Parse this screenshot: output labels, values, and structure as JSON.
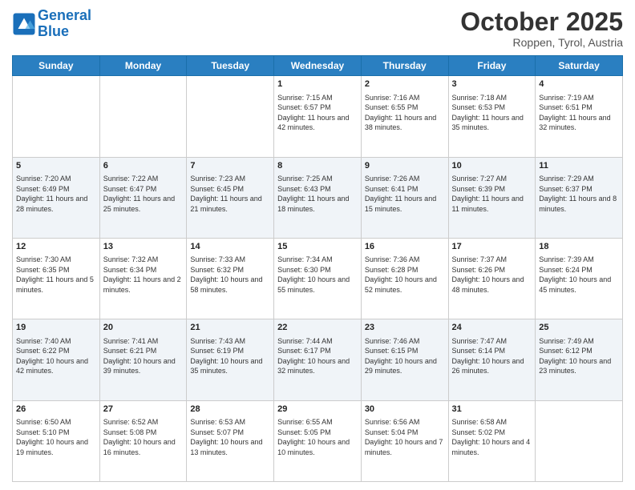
{
  "header": {
    "logo_line1": "General",
    "logo_line2": "Blue",
    "month": "October 2025",
    "location": "Roppen, Tyrol, Austria"
  },
  "days_of_week": [
    "Sunday",
    "Monday",
    "Tuesday",
    "Wednesday",
    "Thursday",
    "Friday",
    "Saturday"
  ],
  "weeks": [
    [
      {
        "day": "",
        "info": ""
      },
      {
        "day": "",
        "info": ""
      },
      {
        "day": "",
        "info": ""
      },
      {
        "day": "1",
        "info": "Sunrise: 7:15 AM\nSunset: 6:57 PM\nDaylight: 11 hours and 42 minutes."
      },
      {
        "day": "2",
        "info": "Sunrise: 7:16 AM\nSunset: 6:55 PM\nDaylight: 11 hours and 38 minutes."
      },
      {
        "day": "3",
        "info": "Sunrise: 7:18 AM\nSunset: 6:53 PM\nDaylight: 11 hours and 35 minutes."
      },
      {
        "day": "4",
        "info": "Sunrise: 7:19 AM\nSunset: 6:51 PM\nDaylight: 11 hours and 32 minutes."
      }
    ],
    [
      {
        "day": "5",
        "info": "Sunrise: 7:20 AM\nSunset: 6:49 PM\nDaylight: 11 hours and 28 minutes."
      },
      {
        "day": "6",
        "info": "Sunrise: 7:22 AM\nSunset: 6:47 PM\nDaylight: 11 hours and 25 minutes."
      },
      {
        "day": "7",
        "info": "Sunrise: 7:23 AM\nSunset: 6:45 PM\nDaylight: 11 hours and 21 minutes."
      },
      {
        "day": "8",
        "info": "Sunrise: 7:25 AM\nSunset: 6:43 PM\nDaylight: 11 hours and 18 minutes."
      },
      {
        "day": "9",
        "info": "Sunrise: 7:26 AM\nSunset: 6:41 PM\nDaylight: 11 hours and 15 minutes."
      },
      {
        "day": "10",
        "info": "Sunrise: 7:27 AM\nSunset: 6:39 PM\nDaylight: 11 hours and 11 minutes."
      },
      {
        "day": "11",
        "info": "Sunrise: 7:29 AM\nSunset: 6:37 PM\nDaylight: 11 hours and 8 minutes."
      }
    ],
    [
      {
        "day": "12",
        "info": "Sunrise: 7:30 AM\nSunset: 6:35 PM\nDaylight: 11 hours and 5 minutes."
      },
      {
        "day": "13",
        "info": "Sunrise: 7:32 AM\nSunset: 6:34 PM\nDaylight: 11 hours and 2 minutes."
      },
      {
        "day": "14",
        "info": "Sunrise: 7:33 AM\nSunset: 6:32 PM\nDaylight: 10 hours and 58 minutes."
      },
      {
        "day": "15",
        "info": "Sunrise: 7:34 AM\nSunset: 6:30 PM\nDaylight: 10 hours and 55 minutes."
      },
      {
        "day": "16",
        "info": "Sunrise: 7:36 AM\nSunset: 6:28 PM\nDaylight: 10 hours and 52 minutes."
      },
      {
        "day": "17",
        "info": "Sunrise: 7:37 AM\nSunset: 6:26 PM\nDaylight: 10 hours and 48 minutes."
      },
      {
        "day": "18",
        "info": "Sunrise: 7:39 AM\nSunset: 6:24 PM\nDaylight: 10 hours and 45 minutes."
      }
    ],
    [
      {
        "day": "19",
        "info": "Sunrise: 7:40 AM\nSunset: 6:22 PM\nDaylight: 10 hours and 42 minutes."
      },
      {
        "day": "20",
        "info": "Sunrise: 7:41 AM\nSunset: 6:21 PM\nDaylight: 10 hours and 39 minutes."
      },
      {
        "day": "21",
        "info": "Sunrise: 7:43 AM\nSunset: 6:19 PM\nDaylight: 10 hours and 35 minutes."
      },
      {
        "day": "22",
        "info": "Sunrise: 7:44 AM\nSunset: 6:17 PM\nDaylight: 10 hours and 32 minutes."
      },
      {
        "day": "23",
        "info": "Sunrise: 7:46 AM\nSunset: 6:15 PM\nDaylight: 10 hours and 29 minutes."
      },
      {
        "day": "24",
        "info": "Sunrise: 7:47 AM\nSunset: 6:14 PM\nDaylight: 10 hours and 26 minutes."
      },
      {
        "day": "25",
        "info": "Sunrise: 7:49 AM\nSunset: 6:12 PM\nDaylight: 10 hours and 23 minutes."
      }
    ],
    [
      {
        "day": "26",
        "info": "Sunrise: 6:50 AM\nSunset: 5:10 PM\nDaylight: 10 hours and 19 minutes."
      },
      {
        "day": "27",
        "info": "Sunrise: 6:52 AM\nSunset: 5:08 PM\nDaylight: 10 hours and 16 minutes."
      },
      {
        "day": "28",
        "info": "Sunrise: 6:53 AM\nSunset: 5:07 PM\nDaylight: 10 hours and 13 minutes."
      },
      {
        "day": "29",
        "info": "Sunrise: 6:55 AM\nSunset: 5:05 PM\nDaylight: 10 hours and 10 minutes."
      },
      {
        "day": "30",
        "info": "Sunrise: 6:56 AM\nSunset: 5:04 PM\nDaylight: 10 hours and 7 minutes."
      },
      {
        "day": "31",
        "info": "Sunrise: 6:58 AM\nSunset: 5:02 PM\nDaylight: 10 hours and 4 minutes."
      },
      {
        "day": "",
        "info": ""
      }
    ]
  ]
}
